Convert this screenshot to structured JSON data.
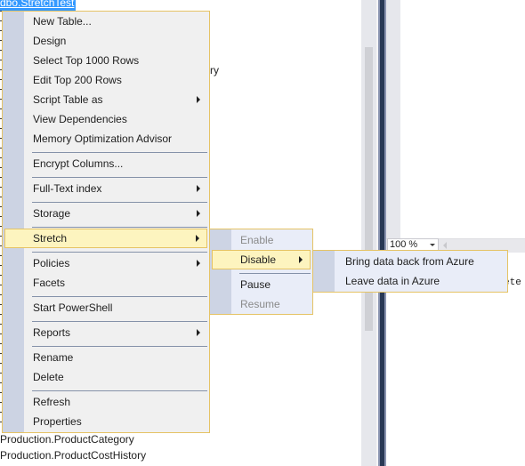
{
  "tree": {
    "selected_node": "dbo.StretchTest",
    "partial_text_behind_menu": "ry",
    "nodes_below": [
      "Production.ProductCategory",
      "Production.ProductCostHistory"
    ]
  },
  "editor": {
    "zoom_level": "100 %",
    "results_partial_text": "ete"
  },
  "context_menu": {
    "items": [
      {
        "label": "New Table...",
        "submenu": false
      },
      {
        "label": "Design",
        "submenu": false
      },
      {
        "label": "Select Top 1000 Rows",
        "submenu": false
      },
      {
        "label": "Edit Top 200 Rows",
        "submenu": false
      },
      {
        "label": "Script Table as",
        "submenu": true
      },
      {
        "label": "View Dependencies",
        "submenu": false
      },
      {
        "label": "Memory Optimization Advisor",
        "submenu": false
      },
      {
        "label": "Encrypt Columns...",
        "submenu": false
      },
      {
        "label": "Full-Text index",
        "submenu": true
      },
      {
        "label": "Storage",
        "submenu": true
      },
      {
        "label": "Stretch",
        "submenu": true,
        "highlighted": true
      },
      {
        "label": "Policies",
        "submenu": true
      },
      {
        "label": "Facets",
        "submenu": false
      },
      {
        "label": "Start PowerShell",
        "submenu": false
      },
      {
        "label": "Reports",
        "submenu": true
      },
      {
        "label": "Rename",
        "submenu": false
      },
      {
        "label": "Delete",
        "submenu": false
      },
      {
        "label": "Refresh",
        "submenu": false
      },
      {
        "label": "Properties",
        "submenu": false
      }
    ]
  },
  "stretch_submenu": {
    "items": [
      {
        "label": "Enable",
        "disabled": true
      },
      {
        "label": "Disable",
        "submenu": true,
        "highlighted": true
      },
      {
        "label": "Pause",
        "disabled": false
      },
      {
        "label": "Resume",
        "disabled": true
      }
    ]
  },
  "disable_submenu": {
    "items": [
      {
        "label": "Bring data back from Azure"
      },
      {
        "label": "Leave data in Azure"
      }
    ]
  },
  "colors": {
    "menu_border": "#e5c365",
    "menu_highlight": "#fdf4bf",
    "menu_gutter": "#ccd3e3",
    "selection_blue": "#3399ff",
    "splitter_dark": "#293955"
  }
}
